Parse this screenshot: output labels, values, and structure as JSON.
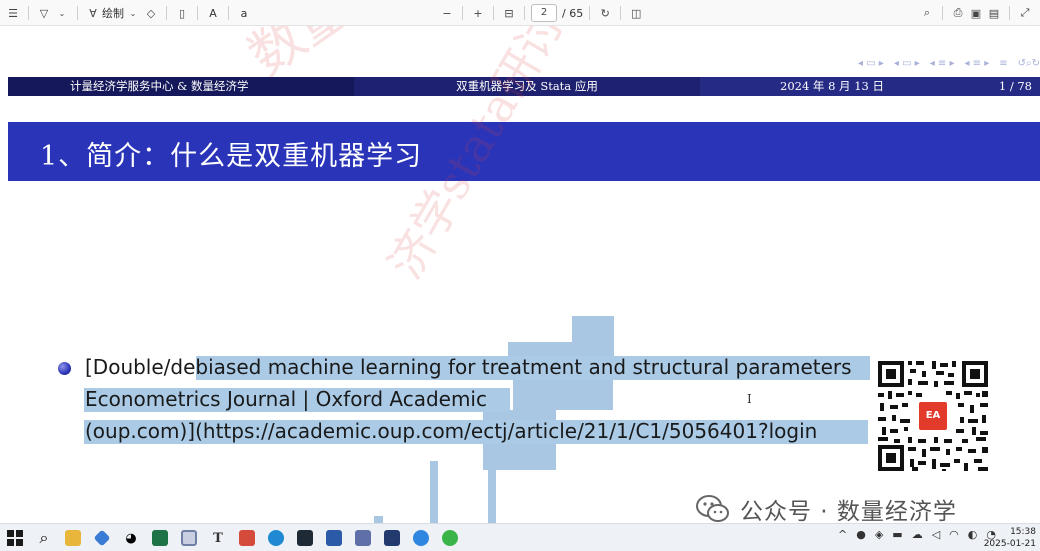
{
  "toolbar": {
    "draw_label": "绘制",
    "text_size_label": "A",
    "read_label": "a",
    "page_current": "2",
    "page_total": "/ 65"
  },
  "slide": {
    "header_left": "计量经济学服务中心 & 数量经济学",
    "header_mid": "双重机器学习及 Stata 应用",
    "header_date": "2024 年 8 月 13 日",
    "header_page": "1 / 78",
    "frame_title": "1、简介：什么是双重机器学习",
    "bullet_line1": "[Double/debiased machine learning for treatment and structural parameters",
    "bullet_line2": "Econometrics Journal | Oxford Academic",
    "bullet_line3": "(oup.com)](https://academic.oup.com/ectj/article/21/1/C1/5056401?login",
    "cursor_glyph": "I"
  },
  "watermark": {
    "text1": "数量经济",
    "text2": "济学stata研讨班"
  },
  "wechat": {
    "label": "公众号 · 数量经济学"
  },
  "qr": {
    "logo_text": "EA"
  },
  "taskbar": {
    "time": "15:38",
    "date": "2025-01-21",
    "tray_chevron": "^"
  },
  "colors": {
    "headline_dark": "#15185a",
    "frame_title": "#2a34b8",
    "selection": "#a9c7e3",
    "logo_red": "#e23b2c"
  }
}
